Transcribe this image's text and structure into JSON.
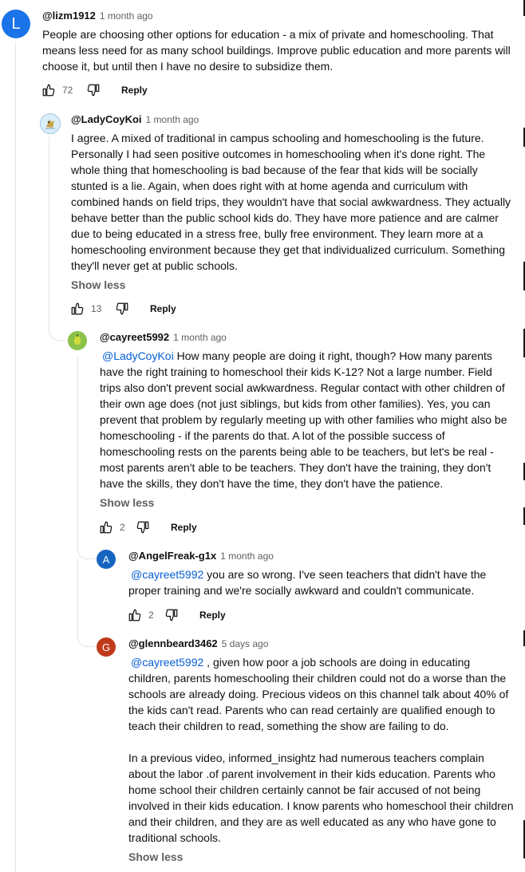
{
  "comments": [
    {
      "avatar_letter": "L",
      "avatar_color": "#1a73e8",
      "handle": "@lizm1912",
      "time": "1 month ago",
      "text": "People are choosing other options for education - a mix of private and homeschooling. That means less need for as many school buildings. Improve public education and more parents will choose it, but until then I have no desire to subsidize them.",
      "likes": "72",
      "reply_label": "Reply"
    },
    {
      "avatar_letter": "",
      "avatar_color": "#cfe6f7",
      "handle": "@LadyCoyKoi",
      "time": "1 month ago",
      "text": "I agree. A mixed of traditional in campus schooling and homeschooling is the future. Personally I had seen positive outcomes in homeschooling when it's done right. The whole thing that homeschooling is bad because of the fear that kids will be socially stunted is a lie. Again, when does right with at home agenda and curriculum with combined hands on field trips, they wouldn't have that social awkwardness. They actually behave better than the public school kids do. They have more patience and are calmer due to being educated in a stress free, bully free environment. They learn more at a homeschooling environment because they get that individualized curriculum. Something they'll never get at public schools.",
      "show_less": "Show less",
      "likes": "13",
      "reply_label": "Reply"
    },
    {
      "avatar_letter": "",
      "avatar_color": "#7cb342",
      "handle": "@cayreet5992",
      "time": "1 month ago",
      "mention": "@LadyCoyKoi",
      "text": "How many people are doing it right, though? How many parents have the right training to homeschool their kids K-12? Not a large number. Field trips also don't prevent social awkwardness. Regular contact with other children of their own age does (not just siblings, but kids from other families). Yes, you can prevent that problem by regularly meeting up with other families who might also be homeschooling - if the parents do that. A lot of the possible success of homeschooling rests on the parents being able to be teachers, but let's be real - most parents aren't able to be teachers. They don't have the training, they don't have the skills, they don't have the time, they don't have the patience.",
      "show_less": "Show less",
      "likes": "2",
      "reply_label": "Reply"
    },
    {
      "avatar_letter": "A",
      "avatar_color": "#1565c0",
      "handle": "@AngelFreak-g1x",
      "time": "1 month ago",
      "mention": "@cayreet5992",
      "text": "you are so wrong. I've seen teachers that didn't have the proper training and we're socially awkward and couldn't communicate.",
      "likes": "2",
      "reply_label": "Reply"
    },
    {
      "avatar_letter": "G",
      "avatar_color": "#c0391b",
      "handle": "@glennbeard3462",
      "time": "5 days ago",
      "mention": "@cayreet5992",
      "text": ", given how poor a job schools are doing in educating children, parents homeschooling their children  could not do a worse than the schools are already doing. Precious videos on this channel talk about 40% of the kids can't read.  Parents who can read certainly are qualified enough to teach their children to read, something the show are failing to do.\n\nIn a previous video, informed_insightz  had numerous teachers complain about the labor .of parent involvement in their kids education.  Parents who home school their children certainly cannot be fair accused of not being involved in their kids education.  I know parents who homeschool their children and their children, and they are as well educated as any who have gone to traditional schools.",
      "show_less": "Show less"
    }
  ]
}
